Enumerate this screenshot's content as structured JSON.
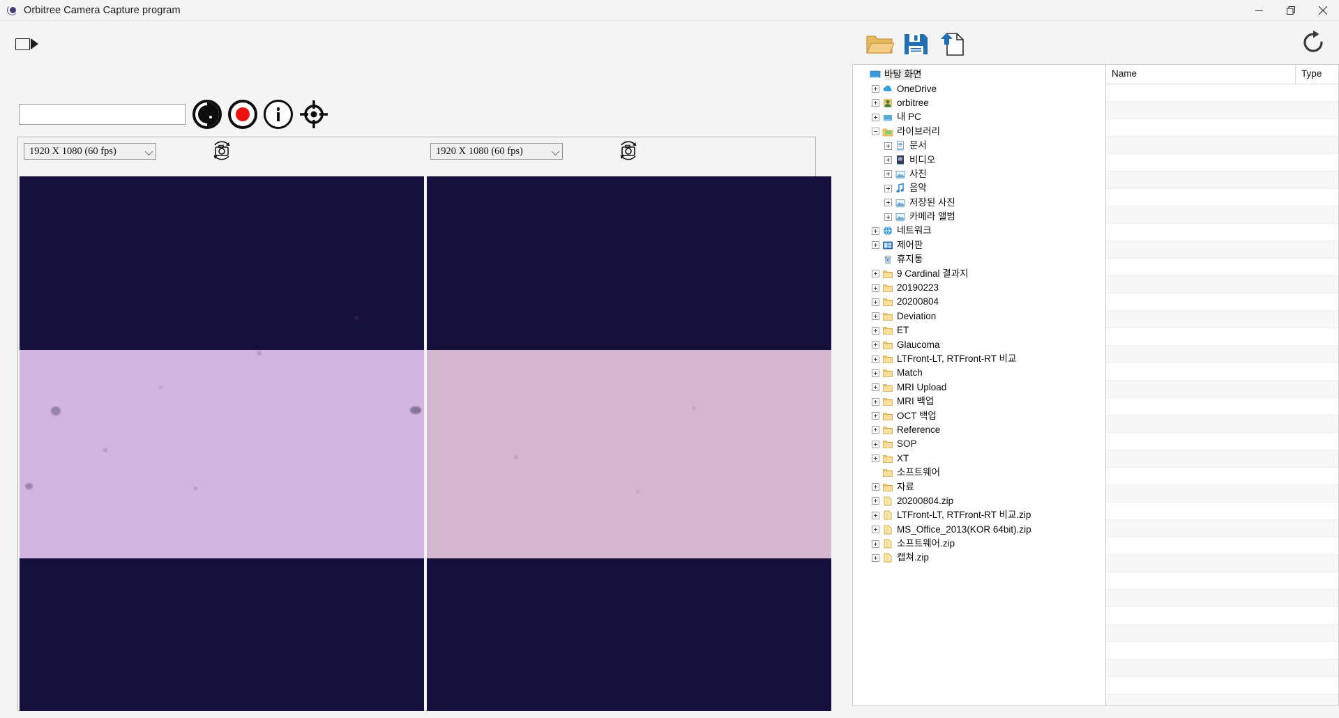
{
  "window": {
    "title": "Orbitree Camera Capture program",
    "app_icon": "orbitree-logo-icon",
    "minimize_label": "Minimize",
    "maximize_label": "Restore",
    "close_label": "Close"
  },
  "toolbar": {
    "camera_icon": "video-camera-icon",
    "name_input_value": "",
    "name_input_placeholder": "",
    "buttons": [
      {
        "name": "contrast-button",
        "icon": "contrast-circle-icon"
      },
      {
        "name": "record-button",
        "icon": "record-red-dot-icon"
      },
      {
        "name": "info-button",
        "icon": "info-circle-icon"
      },
      {
        "name": "target-button",
        "icon": "crosshair-target-icon"
      }
    ]
  },
  "previews": [
    {
      "id": "left",
      "resolution_label": "1920 X 1080   (60 fps)",
      "snapshot_icon": "camera-refresh-icon"
    },
    {
      "id": "right",
      "resolution_label": "1920 X 1080   (60 fps)",
      "snapshot_icon": "camera-refresh-icon"
    }
  ],
  "file_toolbar": {
    "open_label": "Open folder",
    "save_label": "Save",
    "export_label": "Export",
    "refresh_label": "Refresh",
    "open_icon": "open-folder-icon",
    "save_icon": "floppy-save-icon",
    "export_icon": "upload-file-icon",
    "refresh_icon": "refresh-arrow-icon"
  },
  "tree": [
    {
      "label": "바탕 화면",
      "indent": 0,
      "expander": "none",
      "icon": "desktop-icon"
    },
    {
      "label": "OneDrive",
      "indent": 1,
      "expander": "plus",
      "icon": "cloud-icon"
    },
    {
      "label": "orbitree",
      "indent": 1,
      "expander": "plus",
      "icon": "user-icon"
    },
    {
      "label": "내 PC",
      "indent": 1,
      "expander": "plus",
      "icon": "pc-icon"
    },
    {
      "label": "라이브러리",
      "indent": 1,
      "expander": "minus",
      "icon": "library-folder-icon"
    },
    {
      "label": "문서",
      "indent": 2,
      "expander": "plus",
      "icon": "documents-icon"
    },
    {
      "label": "비디오",
      "indent": 2,
      "expander": "plus",
      "icon": "videos-icon"
    },
    {
      "label": "사진",
      "indent": 2,
      "expander": "plus",
      "icon": "pictures-icon"
    },
    {
      "label": "음악",
      "indent": 2,
      "expander": "plus",
      "icon": "music-note-icon"
    },
    {
      "label": "저장된 사진",
      "indent": 2,
      "expander": "plus",
      "icon": "pictures-icon"
    },
    {
      "label": "카메라 앨범",
      "indent": 2,
      "expander": "plus",
      "icon": "pictures-icon"
    },
    {
      "label": "네트워크",
      "indent": 1,
      "expander": "plus",
      "icon": "network-icon"
    },
    {
      "label": "제어판",
      "indent": 1,
      "expander": "plus",
      "icon": "control-panel-icon"
    },
    {
      "label": "휴지통",
      "indent": 1,
      "expander": "none",
      "icon": "recycle-bin-icon"
    },
    {
      "label": "9 Cardinal 결과지",
      "indent": 1,
      "expander": "plus",
      "icon": "folder-icon"
    },
    {
      "label": "20190223",
      "indent": 1,
      "expander": "plus",
      "icon": "folder-icon"
    },
    {
      "label": "20200804",
      "indent": 1,
      "expander": "plus",
      "icon": "folder-icon"
    },
    {
      "label": "Deviation",
      "indent": 1,
      "expander": "plus",
      "icon": "folder-icon"
    },
    {
      "label": "ET",
      "indent": 1,
      "expander": "plus",
      "icon": "folder-icon"
    },
    {
      "label": "Glaucoma",
      "indent": 1,
      "expander": "plus",
      "icon": "folder-icon"
    },
    {
      "label": "LTFront-LT, RTFront-RT 비교",
      "indent": 1,
      "expander": "plus",
      "icon": "folder-icon"
    },
    {
      "label": "Match",
      "indent": 1,
      "expander": "plus",
      "icon": "folder-icon"
    },
    {
      "label": "MRI Upload",
      "indent": 1,
      "expander": "plus",
      "icon": "folder-icon"
    },
    {
      "label": "MRI 백업",
      "indent": 1,
      "expander": "plus",
      "icon": "folder-icon"
    },
    {
      "label": "OCT 백업",
      "indent": 1,
      "expander": "plus",
      "icon": "folder-icon"
    },
    {
      "label": "Reference",
      "indent": 1,
      "expander": "plus",
      "icon": "folder-icon"
    },
    {
      "label": "SOP",
      "indent": 1,
      "expander": "plus",
      "icon": "folder-icon"
    },
    {
      "label": "XT",
      "indent": 1,
      "expander": "plus",
      "icon": "folder-icon"
    },
    {
      "label": "소프트웨어",
      "indent": 1,
      "expander": "none",
      "icon": "folder-icon"
    },
    {
      "label": "자료",
      "indent": 1,
      "expander": "plus",
      "icon": "folder-icon"
    },
    {
      "label": "20200804.zip",
      "indent": 1,
      "expander": "plus",
      "icon": "zip-icon"
    },
    {
      "label": "LTFront-LT, RTFront-RT 비교.zip",
      "indent": 1,
      "expander": "plus",
      "icon": "zip-icon"
    },
    {
      "label": "MS_Office_2013(KOR 64bit).zip",
      "indent": 1,
      "expander": "plus",
      "icon": "zip-icon"
    },
    {
      "label": "소프트웨어.zip",
      "indent": 1,
      "expander": "plus",
      "icon": "zip-icon"
    },
    {
      "label": "캡쳐.zip",
      "indent": 1,
      "expander": "plus",
      "icon": "zip-icon"
    }
  ],
  "file_list": {
    "columns": [
      "Name",
      "Type"
    ],
    "rows": []
  },
  "colors": {
    "video_dark": "#16103c",
    "video_band_left": "#d2b5e0",
    "video_band_right": "#d5b6d0",
    "record_red": "#ee1111",
    "folder_tan": "#e8b962",
    "save_blue": "#1f6fb2",
    "window_bg": "#f4f4f4"
  }
}
